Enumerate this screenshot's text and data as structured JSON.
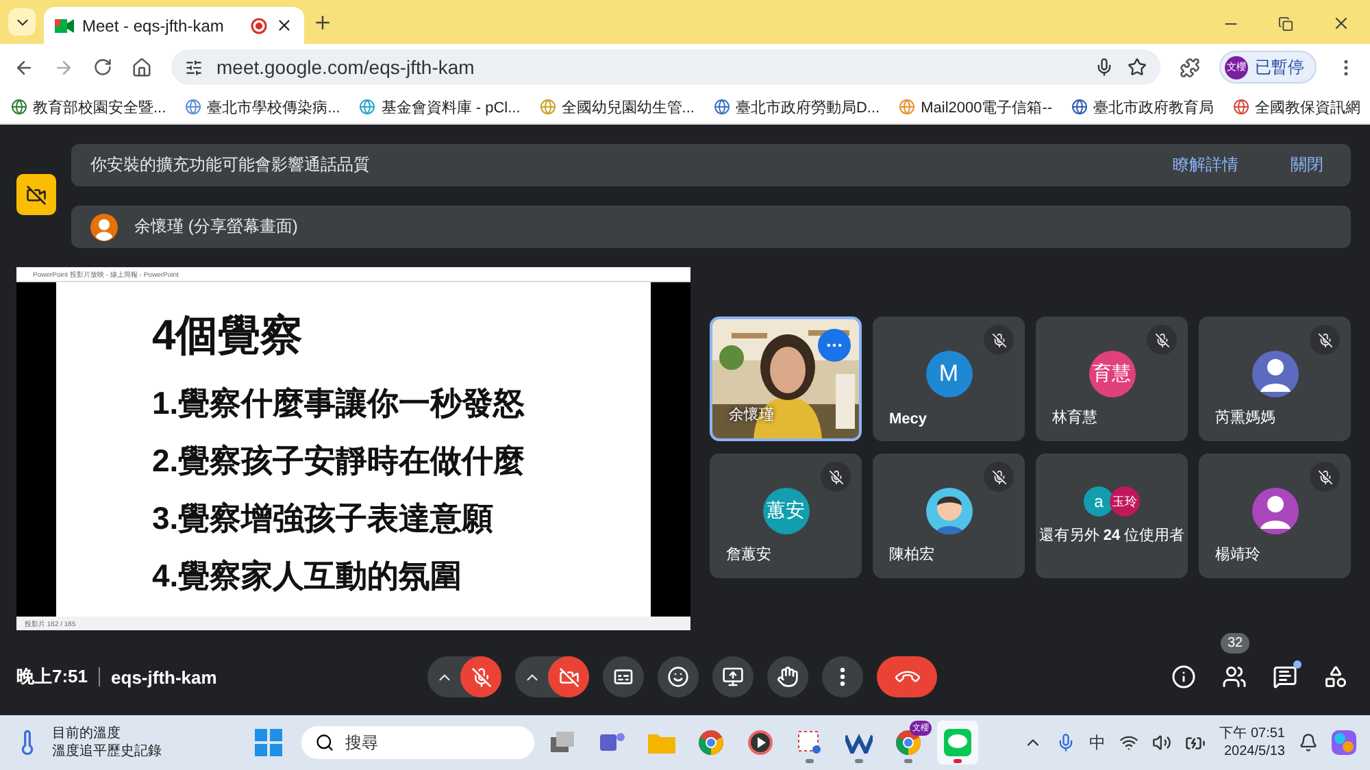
{
  "browser": {
    "tab_title": "Meet - eqs-jfth-kam",
    "url": "meet.google.com/eqs-jfth-kam",
    "profile": {
      "initials": "文櫻",
      "status": "已暫停"
    },
    "bookmarks": [
      {
        "label": "教育部校園安全暨...",
        "color": "#2e7d32"
      },
      {
        "label": "臺北市學校傳染病...",
        "color": "#5c8ed6"
      },
      {
        "label": "基金會資料庫 - pCl...",
        "color": "#26a6c9"
      },
      {
        "label": "全國幼兒園幼生管...",
        "color": "#c9a227"
      },
      {
        "label": "臺北市政府勞動局D...",
        "color": "#3b73c4"
      },
      {
        "label": "Mail2000電子信箱--",
        "color": "#e8912d"
      },
      {
        "label": "臺北市政府教育局",
        "color": "#2f5bb7"
      },
      {
        "label": "全國教保資訊網",
        "color": "#d84a3a"
      }
    ]
  },
  "meet": {
    "notice": {
      "text": "你安裝的擴充功能可能會影響通話品質",
      "links": [
        "瞭解詳情",
        "關閉"
      ]
    },
    "presenting": {
      "text": "余懷瑾 (分享螢幕畫面)"
    },
    "slide": {
      "window_title": "PowerPoint 投影片放映 - 線上簡報 - PowerPoint",
      "title": "4個覺察",
      "lines": [
        "1.覺察什麼事讓你一秒發怒",
        "2.覺察孩子安靜時在做什麼",
        "3.覺察增強孩子表達意願",
        "4.覺察家人互動的氛圍"
      ],
      "status": "投影片 162 / 165"
    },
    "tiles": [
      {
        "kind": "video",
        "name": "余懷瑾",
        "selected": true,
        "muted": false
      },
      {
        "kind": "letter",
        "initials": "M",
        "color": "#1e88d2",
        "name": "Mecy",
        "selected": false,
        "muted": true
      },
      {
        "kind": "letter",
        "initials": "育慧",
        "color": "#e0407b",
        "name": "林育慧",
        "selected": false,
        "muted": true
      },
      {
        "kind": "person",
        "color": "#5c6bc0",
        "name": "芮熏媽媽",
        "selected": false,
        "muted": true
      },
      {
        "kind": "letter",
        "initials": "蕙安",
        "color": "#129eaf",
        "name": "詹蕙安",
        "selected": false,
        "muted": true
      },
      {
        "kind": "cartoon",
        "name": "陳柏宏",
        "selected": false,
        "muted": true
      },
      {
        "kind": "others",
        "avatars": [
          {
            "initials": "a",
            "color": "#129eaf"
          },
          {
            "initials": "玉玲",
            "color": "#c2185b"
          }
        ],
        "label": "還有另外 **24** 位使用者",
        "selected": false,
        "muted": false
      },
      {
        "kind": "person",
        "color": "#ab47bc",
        "name": "楊靖玲",
        "selected": false,
        "muted": true
      }
    ],
    "bottom": {
      "time": "晚上7:51",
      "code": "eqs-jfth-kam",
      "mic_on": false,
      "camera_on": false,
      "people_count": "32",
      "chat_unread": true
    }
  },
  "taskbar": {
    "weather": {
      "title": "目前的溫度",
      "subtitle": "溫度追平歷史記錄"
    },
    "search_placeholder": "搜尋",
    "apps": [
      {
        "kind": "taskview",
        "running": false,
        "selected": false
      },
      {
        "kind": "teams",
        "running": false,
        "selected": false
      },
      {
        "kind": "files",
        "running": false,
        "selected": false
      },
      {
        "kind": "chrome",
        "running": false,
        "selected": false
      },
      {
        "kind": "player",
        "running": false,
        "selected": false
      },
      {
        "kind": "snip",
        "running": true,
        "selected": false
      },
      {
        "kind": "wave",
        "running": true,
        "selected": false
      },
      {
        "kind": "chrome",
        "badge": "文櫻",
        "running": true,
        "selected": false
      },
      {
        "kind": "line",
        "running": true,
        "selected": true
      }
    ],
    "tray": {
      "ime": "中",
      "time": "下午 07:51",
      "date": "2024/5/13"
    }
  }
}
